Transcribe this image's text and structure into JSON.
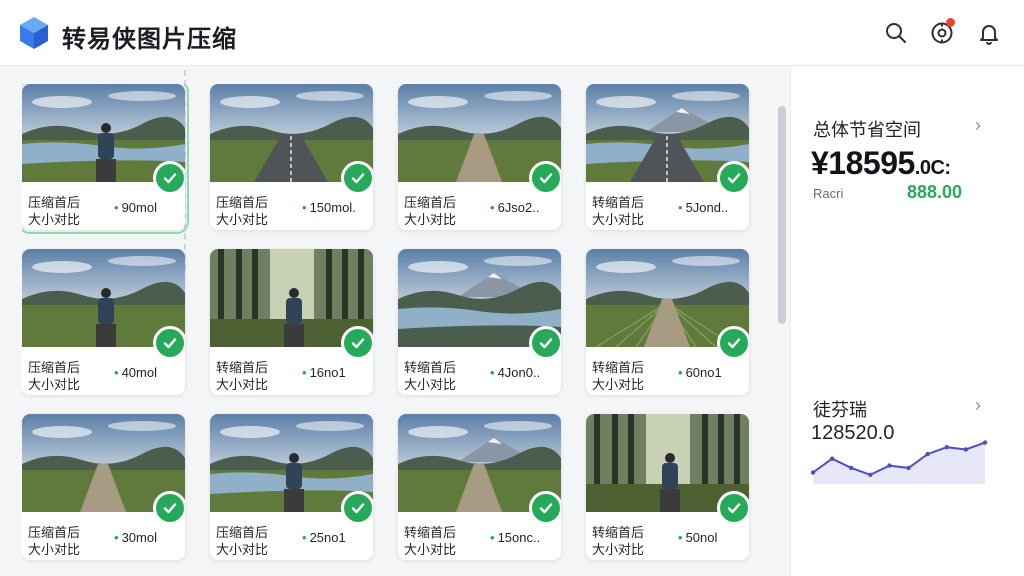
{
  "app": {
    "title": "转易侠图片压缩"
  },
  "header": {
    "icons": [
      "search-icon",
      "settings-icon",
      "bell-icon"
    ],
    "has_notification_dot": true
  },
  "cards": [
    {
      "label_a": "压缩首后",
      "label_b": "大小对比",
      "size": "90mol",
      "scene": "person-lake",
      "selected": true
    },
    {
      "label_a": "压缩首后",
      "label_b": "大小对比",
      "size": "150mol.",
      "scene": "road",
      "selected": false
    },
    {
      "label_a": "压缩首后",
      "label_b": "大小对比",
      "size": "6Jso2..",
      "scene": "path",
      "selected": false
    },
    {
      "label_a": "转缩首后",
      "label_b": "大小对比",
      "size": "5Jond..",
      "scene": "road-lake",
      "selected": false
    },
    {
      "label_a": "压缩首后",
      "label_b": "大小对比",
      "size": "40mol",
      "scene": "person-field",
      "selected": false
    },
    {
      "label_a": "转缩首后",
      "label_b": "大小对比",
      "size": "16no1",
      "scene": "person-forest",
      "selected": false
    },
    {
      "label_a": "转缩首后",
      "label_b": "大小对比",
      "size": "4Jon0..",
      "scene": "lake-mountain",
      "selected": false
    },
    {
      "label_a": "转缩首后",
      "label_b": "大小对比",
      "size": "60no1",
      "scene": "field-rows",
      "selected": false
    },
    {
      "label_a": "压缩首后",
      "label_b": "大小对比",
      "size": "30mol",
      "scene": "path",
      "selected": false
    },
    {
      "label_a": "压缩首后",
      "label_b": "大小对比",
      "size": "25no1",
      "scene": "person-lake",
      "selected": false
    },
    {
      "label_a": "转缩首后",
      "label_b": "大小对比",
      "size": "15onc..",
      "scene": "path-mountain",
      "selected": false
    },
    {
      "label_a": "转缩首后",
      "label_b": "大小对比",
      "size": "50nol",
      "scene": "person-forest",
      "selected": false
    }
  ],
  "sidebar": {
    "savings_title": "总体节省空间",
    "savings_amount": "¥18595",
    "savings_amount_suffix": ".0C:",
    "sub_label": "Racri",
    "sub_value": "888.00",
    "trend_title": "徒芬瑞",
    "trend_value": "128520.0",
    "trend_points": [
      22,
      28,
      24,
      21,
      25,
      24,
      30,
      33,
      32,
      35
    ]
  },
  "colors": {
    "accent_green": "#27a95a",
    "trend_line": "#4e4fc4",
    "notification": "#f0443a"
  }
}
